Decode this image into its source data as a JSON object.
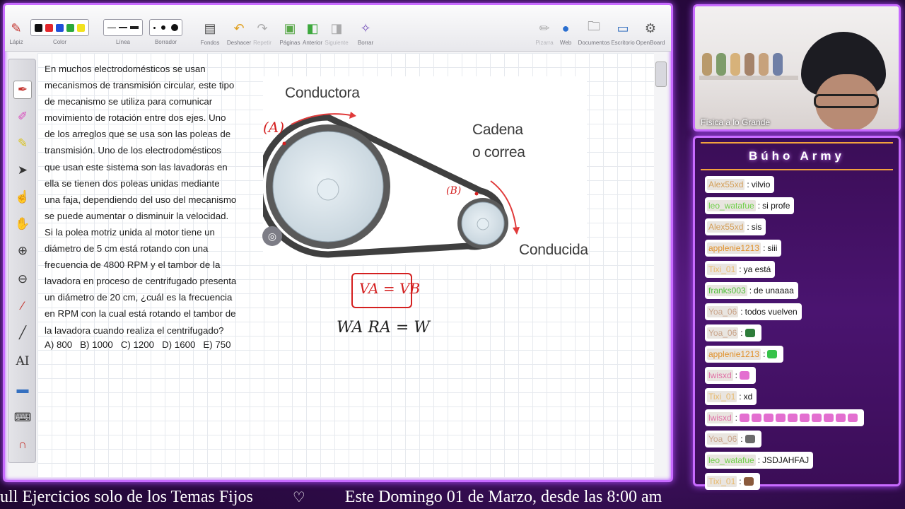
{
  "toolbar": {
    "pen_label": "Lápiz",
    "color_label": "Color",
    "line_label": "Línea",
    "eraser_label": "Borrador",
    "backgrounds_label": "Fondos",
    "undo_label": "Deshacer",
    "redo_label": "Repetir",
    "pages_label": "Páginas",
    "previous_label": "Anterior",
    "next_label": "Siguiente",
    "clear_label": "Borrar",
    "whiteboard_label": "Pizarra",
    "web_label": "Web",
    "documents_label": "Documentos",
    "desktop_label": "Escritorio",
    "app_label": "OpenBoard",
    "colors": [
      "#111111",
      "#e3262b",
      "#1f4fd8",
      "#2aa83a",
      "#f2e21d"
    ]
  },
  "problem": {
    "text": "En muchos electrodomésticos se usan mecanismos de transmisión circular, este tipo de mecanismo se utiliza para comunicar movimiento de rotación entre dos ejes. Uno de los arreglos que se usa son las poleas de transmisión. Uno de los electrodomésticos que usan este sistema son las lavadoras en ella se tienen dos poleas unidas mediante una faja, dependiendo del uso del mecanismo se puede aumentar o disminuir la velocidad. Si la polea motriz unida al motor tiene un diámetro de 5 cm está rotando con una frecuencia de 4800 RPM y el tambor de la lavadora en proceso de centrifugado presenta un diámetro de 20 cm, ¿cuál es la frecuencia en RPM con la cual está rotando el tambor de la lavadora cuando realiza el centrifugado?",
    "options": [
      "A) 800",
      "B) 1000",
      "C) 1200",
      "D) 1600",
      "E) 750"
    ]
  },
  "diagram": {
    "driver_label": "Conductora",
    "chain_label_1": "Cadena",
    "chain_label_2": "o correa",
    "driven_label": "Conducida",
    "point_a": "(A)",
    "point_b": "(B)"
  },
  "handwriting": {
    "equation_1": "Vₐ = Vᴮ",
    "equation_1_display": "VA = VB",
    "equation_2": "WA RA = W"
  },
  "webcam": {
    "caption": "Física a lo Grande"
  },
  "chat": {
    "title": "Búho Army",
    "messages": [
      {
        "user": "Alex55xd",
        "text": "vilvio",
        "color": "#d4a05a"
      },
      {
        "user": "leo_watafue",
        "text": "si profe",
        "color": "#6fcf4a"
      },
      {
        "user": "Alex55xd",
        "text": "sis",
        "color": "#d4a05a"
      },
      {
        "user": "applenie1213",
        "text": "siii",
        "color": "#e0902a"
      },
      {
        "user": "Tixi_01",
        "text": "ya está",
        "color": "#e8b96a"
      },
      {
        "user": "franks003",
        "text": "de unaaaa",
        "color": "#4fbf3a"
      },
      {
        "user": "Yoa_06",
        "text": "todos vuelven",
        "color": "#c9a48a"
      },
      {
        "user": "Yoa_06",
        "text": "",
        "color": "#c9a48a",
        "emote": "#2e7d3a",
        "emotes": 1
      },
      {
        "user": "applenie1213",
        "text": "",
        "color": "#e0902a",
        "emote": "#37c24a",
        "emotes": 1
      },
      {
        "user": "lwisxd",
        "text": "",
        "color": "#e06ea5",
        "emote": "#e36fd0",
        "emotes": 1
      },
      {
        "user": "Tixi_01",
        "text": "xd",
        "color": "#e8b96a"
      },
      {
        "user": "lwisxd",
        "text": "",
        "color": "#e06ea5",
        "emote": "#e36fd0",
        "emotes": 10
      },
      {
        "user": "Yoa_06",
        "text": "",
        "color": "#c9a48a",
        "emote": "#6b6b6b",
        "emotes": 1
      },
      {
        "user": "leo_watafue",
        "text": "JSDJAHFAJ",
        "color": "#6fcf4a"
      },
      {
        "user": "Tixi_01",
        "text": "",
        "color": "#e8b96a",
        "emote": "#8a5a3c",
        "emotes": 1
      }
    ]
  },
  "ticker": {
    "text_1": "ull Ejercicios solo de los Temas Fijos",
    "heart": "♡",
    "text_2": "Este Domingo 01 de Marzo, desde las 8:00 am"
  }
}
